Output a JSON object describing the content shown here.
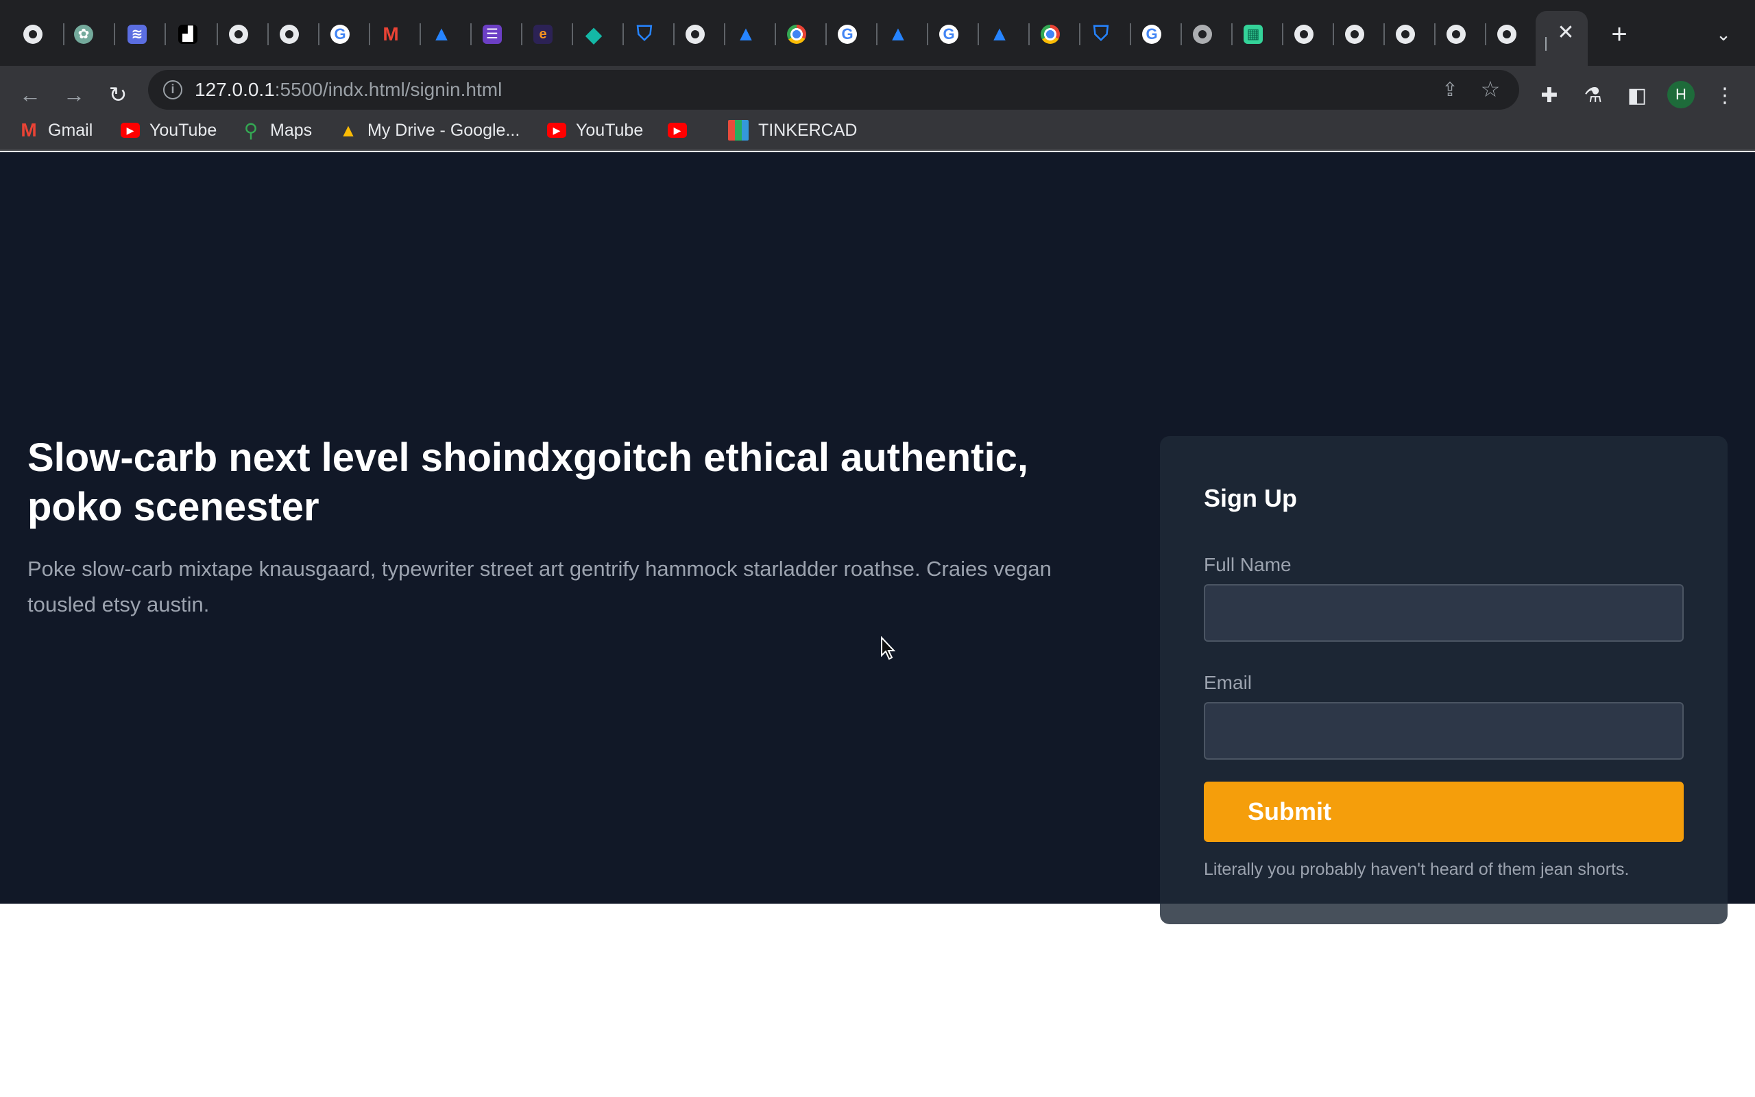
{
  "browser": {
    "tabs": [
      {
        "icon": "globe-icon"
      },
      {
        "icon": "openai-icon"
      },
      {
        "icon": "layers-icon"
      },
      {
        "icon": "unsplash-icon"
      },
      {
        "icon": "globe-icon"
      },
      {
        "icon": "globe-icon"
      },
      {
        "icon": "google-icon"
      },
      {
        "icon": "gmail-icon"
      },
      {
        "icon": "atlassian-icon"
      },
      {
        "icon": "forms-icon"
      },
      {
        "icon": "eclipse-icon"
      },
      {
        "icon": "diamond-icon"
      },
      {
        "icon": "bitbucket-icon"
      },
      {
        "icon": "globe-icon"
      },
      {
        "icon": "atlassian-icon"
      },
      {
        "icon": "chrome-icon"
      },
      {
        "icon": "google-icon"
      },
      {
        "icon": "atlassian-icon"
      },
      {
        "icon": "google-icon"
      },
      {
        "icon": "atlassian-icon"
      },
      {
        "icon": "chrome-icon"
      },
      {
        "icon": "bitbucket-icon"
      },
      {
        "icon": "google-icon"
      },
      {
        "icon": "globe-icon"
      },
      {
        "icon": "sheets-icon"
      },
      {
        "icon": "globe-icon"
      },
      {
        "icon": "globe-icon"
      },
      {
        "icon": "globe-icon"
      },
      {
        "icon": "globe-icon"
      },
      {
        "icon": "globe-icon"
      }
    ],
    "active_tab_close": "✕",
    "url_host": "127.0.0.1",
    "url_path": ":5500/indx.html/signin.html",
    "profile_initial": "H",
    "bookmarks": [
      {
        "label": "Gmail",
        "icon": "gmail-icon"
      },
      {
        "label": "YouTube",
        "icon": "youtube-icon"
      },
      {
        "label": "Maps",
        "icon": "maps-icon"
      },
      {
        "label": "My Drive - Google...",
        "icon": "drive-icon"
      },
      {
        "label": "YouTube",
        "icon": "youtube-icon"
      },
      {
        "label": "",
        "icon": "youtube-icon"
      },
      {
        "label": "TINKERCAD",
        "icon": "tinkercad-icon"
      }
    ]
  },
  "hero": {
    "title": "Slow-carb next level shoindxgoitch ethical authentic, poko scenester",
    "text": "Poke slow-carb mixtape knausgaard, typewriter street art gentrify hammock starladder roathse. Craies vegan tousled etsy austin."
  },
  "form": {
    "title": "Sign Up",
    "full_name_label": "Full Name",
    "full_name_value": "",
    "email_label": "Email",
    "email_value": "",
    "submit_label": "Submit",
    "note": "Literally you probably haven't heard of them jean shorts."
  },
  "colors": {
    "page_bg": "#111827",
    "card_bg": "#1f2937",
    "accent": "#f59e0b"
  }
}
